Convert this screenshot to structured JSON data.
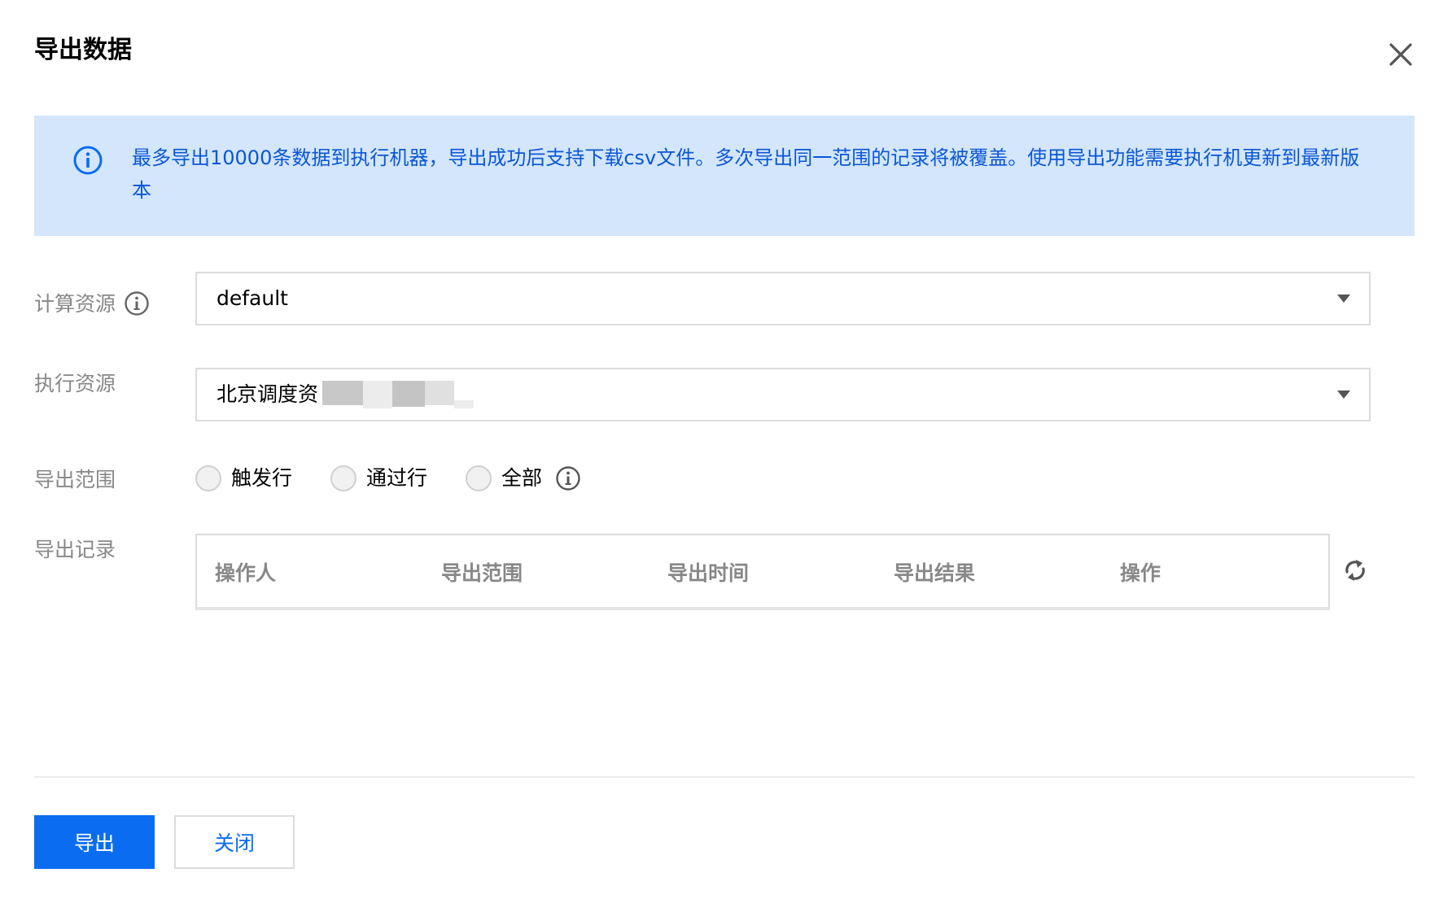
{
  "dialog": {
    "title": "导出数据"
  },
  "notice": {
    "text": "最多导出10000条数据到执行机器，导出成功后支持下载csv文件。多次导出同一范围的记录将被覆盖。使用导出功能需要执行机更新到最新版本"
  },
  "form": {
    "compute": {
      "label": "计算资源",
      "value": "default"
    },
    "exec": {
      "label": "执行资源",
      "value": "北京调度资"
    },
    "range": {
      "label": "导出范围",
      "options": [
        "触发行",
        "通过行",
        "全部"
      ]
    },
    "records": {
      "label": "导出记录",
      "columns": [
        "操作人",
        "导出范围",
        "导出时间",
        "导出结果",
        "操作"
      ]
    }
  },
  "footer": {
    "primary_label": "导出",
    "secondary_label": "关闭"
  },
  "colors": {
    "primary": "#0a6cf0",
    "notice_bg": "#d4e6fc",
    "notice_text": "#0a57d6",
    "label": "#888888"
  },
  "icons": [
    "close-icon",
    "info-circle-icon",
    "info-icon",
    "caret-down-icon",
    "refresh-icon"
  ]
}
